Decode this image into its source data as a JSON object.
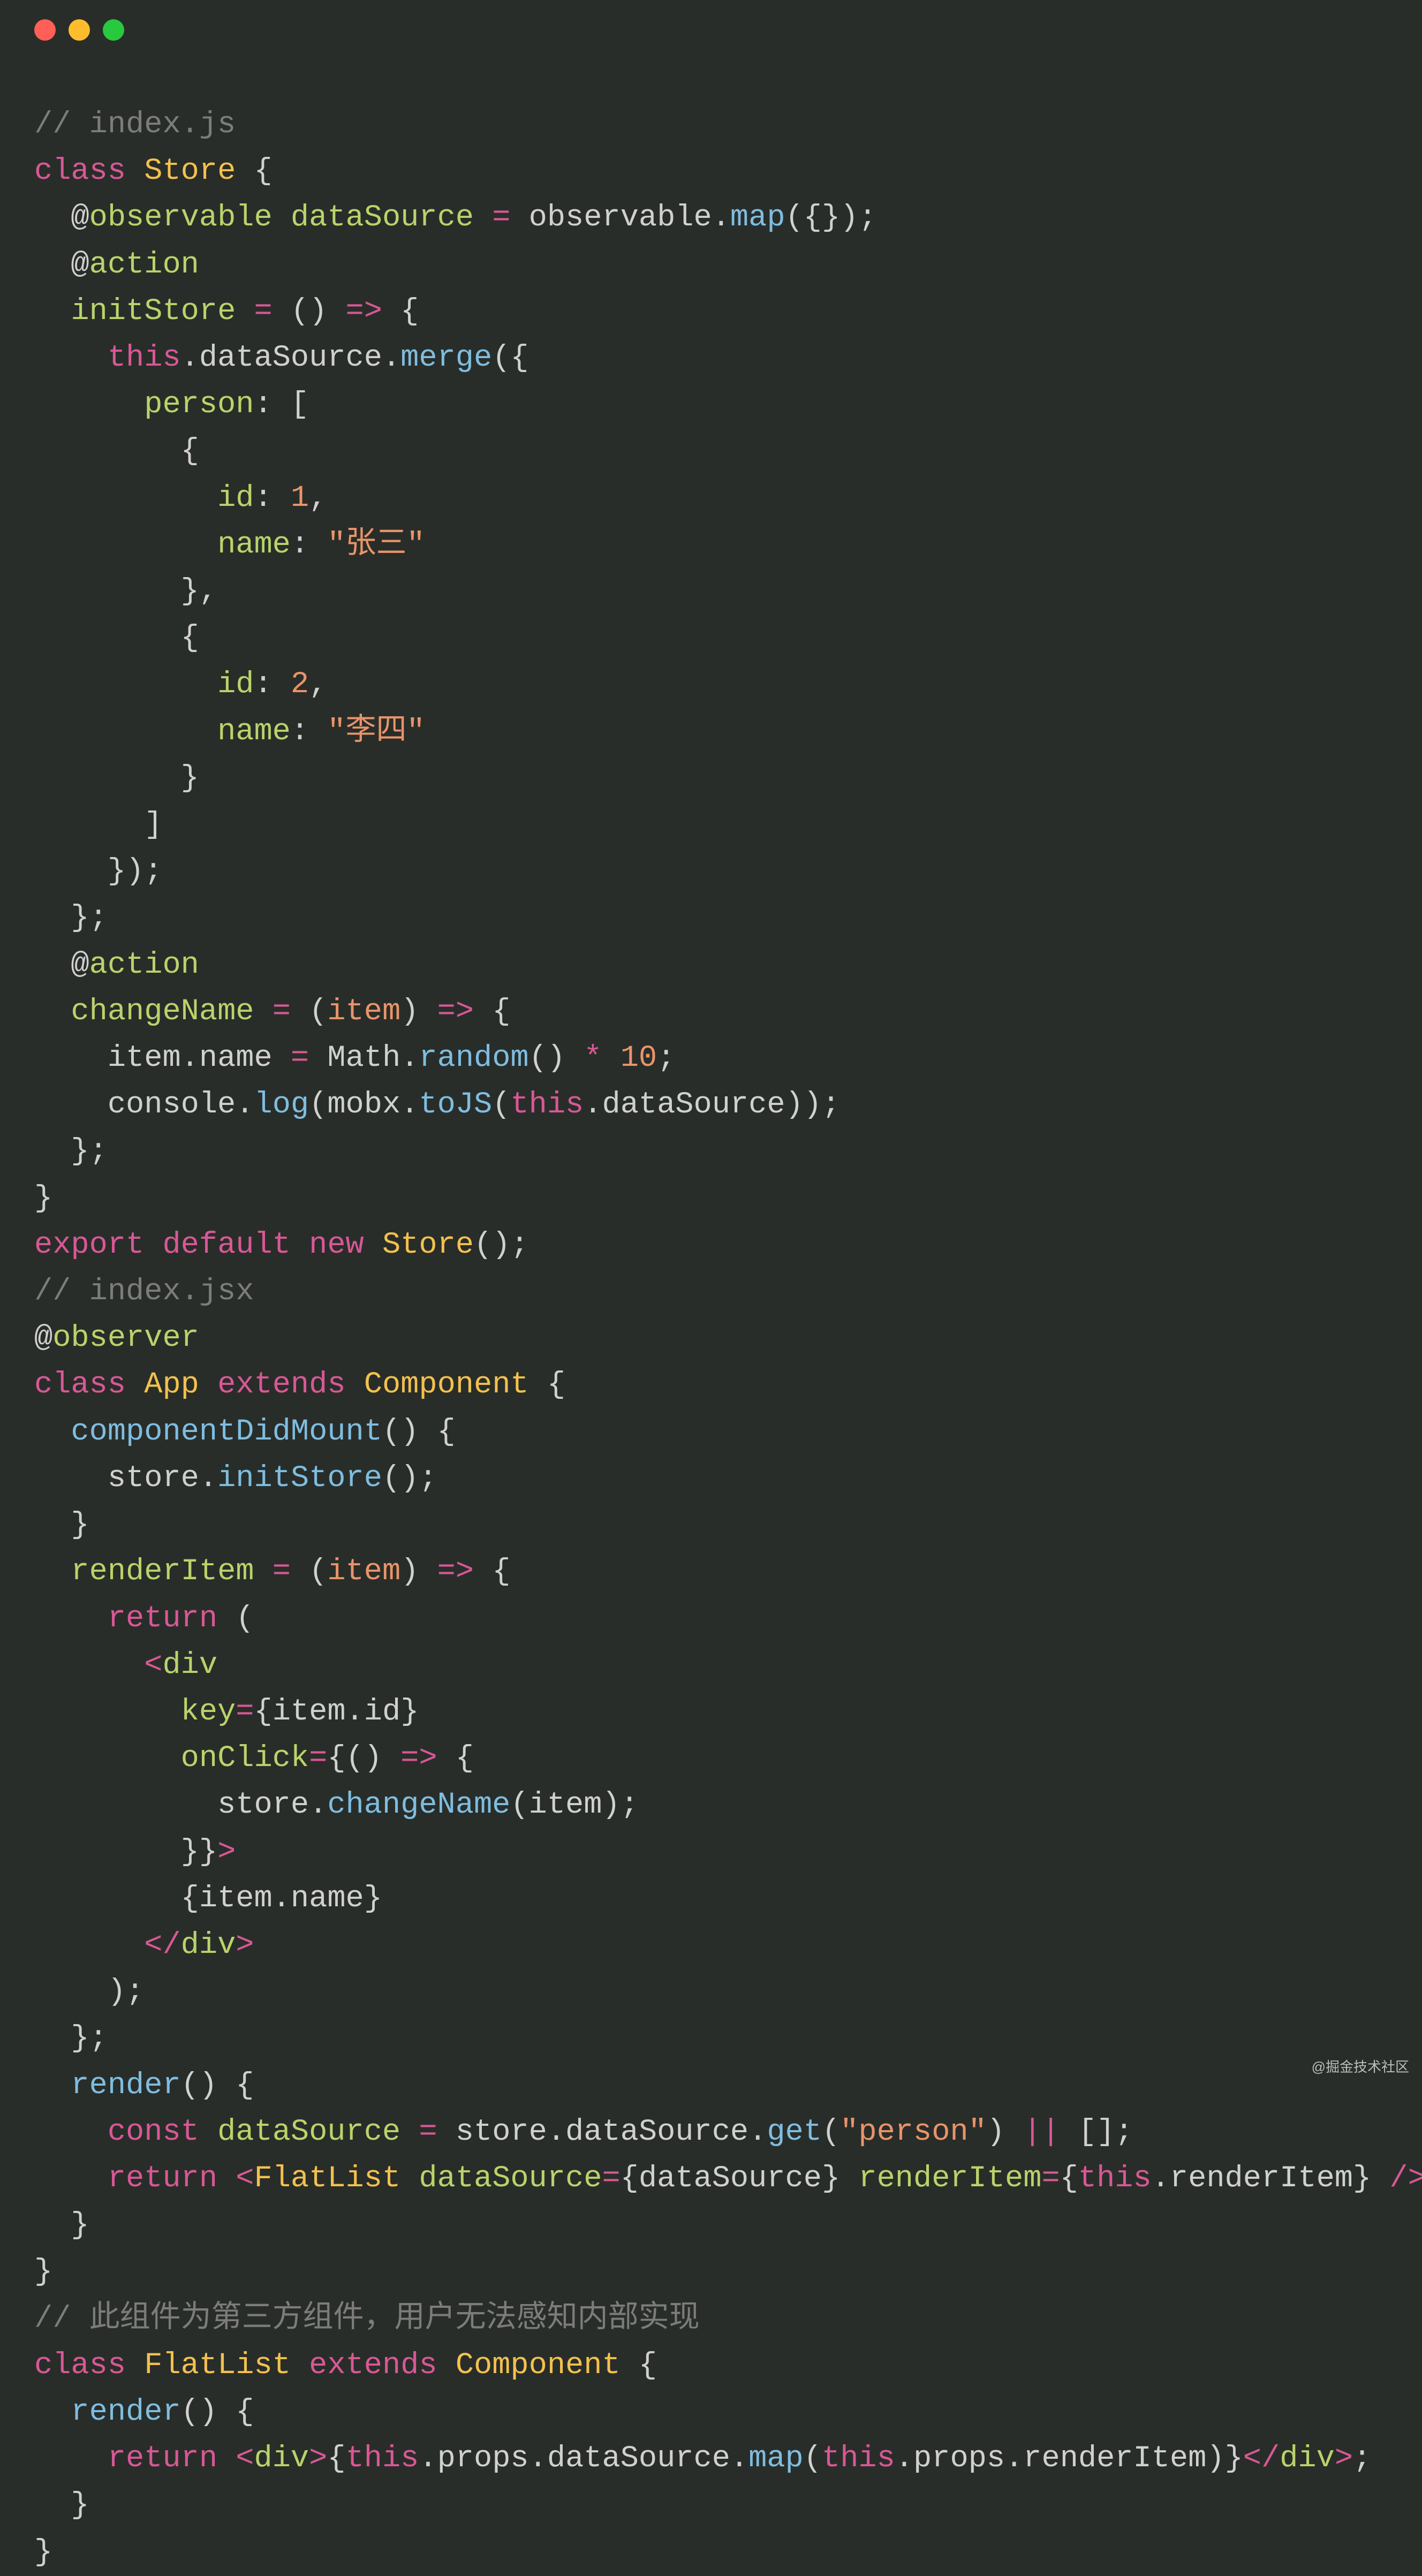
{
  "watermark": "@掘金技术社区",
  "tokens": [
    {
      "cls": "c-comment",
      "t": "// index.js"
    },
    {
      "t": "\n"
    },
    {
      "cls": "c-keyword",
      "t": "class"
    },
    {
      "t": " "
    },
    {
      "cls": "c-classname",
      "t": "Store"
    },
    {
      "t": " {"
    },
    {
      "t": "\n"
    },
    {
      "t": "  "
    },
    {
      "cls": "c-decorator",
      "t": "@"
    },
    {
      "cls": "c-decname",
      "t": "observable"
    },
    {
      "t": " "
    },
    {
      "cls": "c-prop",
      "t": "dataSource"
    },
    {
      "t": " "
    },
    {
      "cls": "c-op",
      "t": "="
    },
    {
      "t": " "
    },
    {
      "cls": "c-ident",
      "t": "observable"
    },
    {
      "t": "."
    },
    {
      "cls": "c-method",
      "t": "map"
    },
    {
      "t": "({});"
    },
    {
      "t": "\n"
    },
    {
      "t": "  "
    },
    {
      "cls": "c-decorator",
      "t": "@"
    },
    {
      "cls": "c-decname",
      "t": "action"
    },
    {
      "t": "\n"
    },
    {
      "t": "  "
    },
    {
      "cls": "c-prop",
      "t": "initStore"
    },
    {
      "t": " "
    },
    {
      "cls": "c-op",
      "t": "="
    },
    {
      "t": " () "
    },
    {
      "cls": "c-op",
      "t": "=>"
    },
    {
      "t": " {"
    },
    {
      "t": "\n"
    },
    {
      "t": "    "
    },
    {
      "cls": "c-keyword",
      "t": "this"
    },
    {
      "t": "."
    },
    {
      "cls": "c-ident",
      "t": "dataSource"
    },
    {
      "t": "."
    },
    {
      "cls": "c-method",
      "t": "merge"
    },
    {
      "t": "({"
    },
    {
      "t": "\n"
    },
    {
      "t": "      "
    },
    {
      "cls": "c-prop",
      "t": "person"
    },
    {
      "t": ": ["
    },
    {
      "t": "\n"
    },
    {
      "t": "        {"
    },
    {
      "t": "\n"
    },
    {
      "t": "          "
    },
    {
      "cls": "c-prop",
      "t": "id"
    },
    {
      "t": ": "
    },
    {
      "cls": "c-num",
      "t": "1"
    },
    {
      "t": ","
    },
    {
      "t": "\n"
    },
    {
      "t": "          "
    },
    {
      "cls": "c-prop",
      "t": "name"
    },
    {
      "t": ": "
    },
    {
      "cls": "c-str",
      "t": "\"张三\""
    },
    {
      "t": "\n"
    },
    {
      "t": "        },"
    },
    {
      "t": "\n"
    },
    {
      "t": "        {"
    },
    {
      "t": "\n"
    },
    {
      "t": "          "
    },
    {
      "cls": "c-prop",
      "t": "id"
    },
    {
      "t": ": "
    },
    {
      "cls": "c-num",
      "t": "2"
    },
    {
      "t": ","
    },
    {
      "t": "\n"
    },
    {
      "t": "          "
    },
    {
      "cls": "c-prop",
      "t": "name"
    },
    {
      "t": ": "
    },
    {
      "cls": "c-str",
      "t": "\"李四\""
    },
    {
      "t": "\n"
    },
    {
      "t": "        }"
    },
    {
      "t": "\n"
    },
    {
      "t": "      ]"
    },
    {
      "t": "\n"
    },
    {
      "t": "    });"
    },
    {
      "t": "\n"
    },
    {
      "t": "  };"
    },
    {
      "t": "\n"
    },
    {
      "t": "  "
    },
    {
      "cls": "c-decorator",
      "t": "@"
    },
    {
      "cls": "c-decname",
      "t": "action"
    },
    {
      "t": "\n"
    },
    {
      "t": "  "
    },
    {
      "cls": "c-prop",
      "t": "changeName"
    },
    {
      "t": " "
    },
    {
      "cls": "c-op",
      "t": "="
    },
    {
      "t": " ("
    },
    {
      "cls": "c-var",
      "t": "item"
    },
    {
      "t": ") "
    },
    {
      "cls": "c-op",
      "t": "=>"
    },
    {
      "t": " {"
    },
    {
      "t": "\n"
    },
    {
      "t": "    "
    },
    {
      "cls": "c-ident",
      "t": "item"
    },
    {
      "t": "."
    },
    {
      "cls": "c-ident",
      "t": "name"
    },
    {
      "t": " "
    },
    {
      "cls": "c-op",
      "t": "="
    },
    {
      "t": " "
    },
    {
      "cls": "c-ident",
      "t": "Math"
    },
    {
      "t": "."
    },
    {
      "cls": "c-method",
      "t": "random"
    },
    {
      "t": "() "
    },
    {
      "cls": "c-op",
      "t": "*"
    },
    {
      "t": " "
    },
    {
      "cls": "c-num",
      "t": "10"
    },
    {
      "t": ";"
    },
    {
      "t": "\n"
    },
    {
      "t": "    "
    },
    {
      "cls": "c-ident",
      "t": "console"
    },
    {
      "t": "."
    },
    {
      "cls": "c-method",
      "t": "log"
    },
    {
      "t": "("
    },
    {
      "cls": "c-ident",
      "t": "mobx"
    },
    {
      "t": "."
    },
    {
      "cls": "c-method",
      "t": "toJS"
    },
    {
      "t": "("
    },
    {
      "cls": "c-keyword",
      "t": "this"
    },
    {
      "t": "."
    },
    {
      "cls": "c-ident",
      "t": "dataSource"
    },
    {
      "t": "));"
    },
    {
      "t": "\n"
    },
    {
      "t": "  };"
    },
    {
      "t": "\n"
    },
    {
      "t": "}"
    },
    {
      "t": "\n"
    },
    {
      "cls": "c-keyword",
      "t": "export"
    },
    {
      "t": " "
    },
    {
      "cls": "c-keyword",
      "t": "default"
    },
    {
      "t": " "
    },
    {
      "cls": "c-keyword",
      "t": "new"
    },
    {
      "t": " "
    },
    {
      "cls": "c-classname",
      "t": "Store"
    },
    {
      "t": "();"
    },
    {
      "t": "\n"
    },
    {
      "cls": "c-comment",
      "t": "// index.jsx"
    },
    {
      "t": "\n"
    },
    {
      "cls": "c-decorator",
      "t": "@"
    },
    {
      "cls": "c-decname",
      "t": "observer"
    },
    {
      "t": "\n"
    },
    {
      "cls": "c-keyword",
      "t": "class"
    },
    {
      "t": " "
    },
    {
      "cls": "c-classname",
      "t": "App"
    },
    {
      "t": " "
    },
    {
      "cls": "c-keyword",
      "t": "extends"
    },
    {
      "t": " "
    },
    {
      "cls": "c-classname",
      "t": "Component"
    },
    {
      "t": " {"
    },
    {
      "t": "\n"
    },
    {
      "t": "  "
    },
    {
      "cls": "c-method",
      "t": "componentDidMount"
    },
    {
      "t": "() {"
    },
    {
      "t": "\n"
    },
    {
      "t": "    "
    },
    {
      "cls": "c-ident",
      "t": "store"
    },
    {
      "t": "."
    },
    {
      "cls": "c-method",
      "t": "initStore"
    },
    {
      "t": "();"
    },
    {
      "t": "\n"
    },
    {
      "t": "  }"
    },
    {
      "t": "\n"
    },
    {
      "t": "  "
    },
    {
      "cls": "c-prop",
      "t": "renderItem"
    },
    {
      "t": " "
    },
    {
      "cls": "c-op",
      "t": "="
    },
    {
      "t": " ("
    },
    {
      "cls": "c-var",
      "t": "item"
    },
    {
      "t": ") "
    },
    {
      "cls": "c-op",
      "t": "=>"
    },
    {
      "t": " {"
    },
    {
      "t": "\n"
    },
    {
      "t": "    "
    },
    {
      "cls": "c-keyword",
      "t": "return"
    },
    {
      "t": " ("
    },
    {
      "t": "\n"
    },
    {
      "t": "      "
    },
    {
      "cls": "c-jsx-tag",
      "t": "<"
    },
    {
      "cls": "c-jsx-name",
      "t": "div"
    },
    {
      "t": "\n"
    },
    {
      "t": "        "
    },
    {
      "cls": "c-jsx-attr",
      "t": "key"
    },
    {
      "cls": "c-op",
      "t": "="
    },
    {
      "cls": "c-punc",
      "t": "{"
    },
    {
      "cls": "c-ident",
      "t": "item"
    },
    {
      "t": "."
    },
    {
      "cls": "c-ident",
      "t": "id"
    },
    {
      "cls": "c-punc",
      "t": "}"
    },
    {
      "t": "\n"
    },
    {
      "t": "        "
    },
    {
      "cls": "c-jsx-attr",
      "t": "onClick"
    },
    {
      "cls": "c-op",
      "t": "="
    },
    {
      "cls": "c-punc",
      "t": "{"
    },
    {
      "t": "() "
    },
    {
      "cls": "c-op",
      "t": "=>"
    },
    {
      "t": " {"
    },
    {
      "t": "\n"
    },
    {
      "t": "          "
    },
    {
      "cls": "c-ident",
      "t": "store"
    },
    {
      "t": "."
    },
    {
      "cls": "c-method",
      "t": "changeName"
    },
    {
      "t": "("
    },
    {
      "cls": "c-ident",
      "t": "item"
    },
    {
      "t": ");"
    },
    {
      "t": "\n"
    },
    {
      "t": "        }"
    },
    {
      "cls": "c-punc",
      "t": "}"
    },
    {
      "cls": "c-jsx-tag",
      "t": ">"
    },
    {
      "t": "\n"
    },
    {
      "t": "        "
    },
    {
      "cls": "c-punc",
      "t": "{"
    },
    {
      "cls": "c-ident",
      "t": "item"
    },
    {
      "t": "."
    },
    {
      "cls": "c-ident",
      "t": "name"
    },
    {
      "cls": "c-punc",
      "t": "}"
    },
    {
      "t": "\n"
    },
    {
      "t": "      "
    },
    {
      "cls": "c-jsx-tag",
      "t": "</"
    },
    {
      "cls": "c-jsx-name",
      "t": "div"
    },
    {
      "cls": "c-jsx-tag",
      "t": ">"
    },
    {
      "t": "\n"
    },
    {
      "t": "    );"
    },
    {
      "t": "\n"
    },
    {
      "t": "  };"
    },
    {
      "t": "\n"
    },
    {
      "t": "  "
    },
    {
      "cls": "c-method",
      "t": "render"
    },
    {
      "t": "() {"
    },
    {
      "t": "\n"
    },
    {
      "t": "    "
    },
    {
      "cls": "c-keyword",
      "t": "const"
    },
    {
      "t": " "
    },
    {
      "cls": "c-prop",
      "t": "dataSource"
    },
    {
      "t": " "
    },
    {
      "cls": "c-op",
      "t": "="
    },
    {
      "t": " "
    },
    {
      "cls": "c-ident",
      "t": "store"
    },
    {
      "t": "."
    },
    {
      "cls": "c-ident",
      "t": "dataSource"
    },
    {
      "t": "."
    },
    {
      "cls": "c-method",
      "t": "get"
    },
    {
      "t": "("
    },
    {
      "cls": "c-str",
      "t": "\"person\""
    },
    {
      "t": ") "
    },
    {
      "cls": "c-op",
      "t": "||"
    },
    {
      "t": " [];"
    },
    {
      "t": "\n"
    },
    {
      "t": "    "
    },
    {
      "cls": "c-keyword",
      "t": "return"
    },
    {
      "t": " "
    },
    {
      "cls": "c-jsx-tag",
      "t": "<"
    },
    {
      "cls": "c-jsx-comp",
      "t": "FlatList"
    },
    {
      "t": " "
    },
    {
      "cls": "c-jsx-attr",
      "t": "dataSource"
    },
    {
      "cls": "c-op",
      "t": "="
    },
    {
      "cls": "c-punc",
      "t": "{"
    },
    {
      "cls": "c-ident",
      "t": "dataSource"
    },
    {
      "cls": "c-punc",
      "t": "}"
    },
    {
      "t": " "
    },
    {
      "cls": "c-jsx-attr",
      "t": "renderItem"
    },
    {
      "cls": "c-op",
      "t": "="
    },
    {
      "cls": "c-punc",
      "t": "{"
    },
    {
      "cls": "c-keyword",
      "t": "this"
    },
    {
      "t": "."
    },
    {
      "cls": "c-ident",
      "t": "renderItem"
    },
    {
      "cls": "c-punc",
      "t": "}"
    },
    {
      "t": " "
    },
    {
      "cls": "c-jsx-tag",
      "t": "/>"
    },
    {
      "t": ";"
    },
    {
      "t": "\n"
    },
    {
      "t": "  }"
    },
    {
      "t": "\n"
    },
    {
      "t": "}"
    },
    {
      "t": "\n"
    },
    {
      "cls": "c-comment",
      "t": "// 此组件为第三方组件，用户无法感知内部实现"
    },
    {
      "t": "\n"
    },
    {
      "cls": "c-keyword",
      "t": "class"
    },
    {
      "t": " "
    },
    {
      "cls": "c-classname",
      "t": "FlatList"
    },
    {
      "t": " "
    },
    {
      "cls": "c-keyword",
      "t": "extends"
    },
    {
      "t": " "
    },
    {
      "cls": "c-classname",
      "t": "Component"
    },
    {
      "t": " {"
    },
    {
      "t": "\n"
    },
    {
      "t": "  "
    },
    {
      "cls": "c-method",
      "t": "render"
    },
    {
      "t": "() {"
    },
    {
      "t": "\n"
    },
    {
      "t": "    "
    },
    {
      "cls": "c-keyword",
      "t": "return"
    },
    {
      "t": " "
    },
    {
      "cls": "c-jsx-tag",
      "t": "<"
    },
    {
      "cls": "c-jsx-name",
      "t": "div"
    },
    {
      "cls": "c-jsx-tag",
      "t": ">"
    },
    {
      "cls": "c-punc",
      "t": "{"
    },
    {
      "cls": "c-keyword",
      "t": "this"
    },
    {
      "t": "."
    },
    {
      "cls": "c-ident",
      "t": "props"
    },
    {
      "t": "."
    },
    {
      "cls": "c-ident",
      "t": "dataSource"
    },
    {
      "t": "."
    },
    {
      "cls": "c-method",
      "t": "map"
    },
    {
      "t": "("
    },
    {
      "cls": "c-keyword",
      "t": "this"
    },
    {
      "t": "."
    },
    {
      "cls": "c-ident",
      "t": "props"
    },
    {
      "t": "."
    },
    {
      "cls": "c-ident",
      "t": "renderItem"
    },
    {
      "t": ")"
    },
    {
      "cls": "c-punc",
      "t": "}"
    },
    {
      "cls": "c-jsx-tag",
      "t": "</"
    },
    {
      "cls": "c-jsx-name",
      "t": "div"
    },
    {
      "cls": "c-jsx-tag",
      "t": ">"
    },
    {
      "t": ";"
    },
    {
      "t": "\n"
    },
    {
      "t": "  }"
    },
    {
      "t": "\n"
    },
    {
      "t": "}"
    }
  ]
}
